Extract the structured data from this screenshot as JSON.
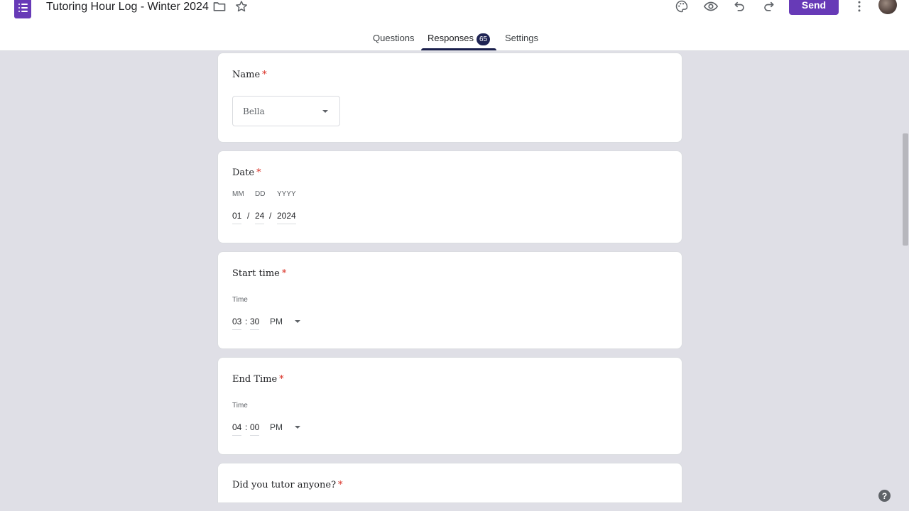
{
  "header": {
    "title": "Tutoring Hour Log - Winter 2024",
    "icons": [
      "forms-logo-icon",
      "folder-icon",
      "star-icon",
      "palette-icon",
      "preview-eye-icon",
      "undo-icon",
      "redo-icon",
      "more-vert-icon",
      "help-icon"
    ],
    "send_label": "Send"
  },
  "tabs": {
    "questions": "Questions",
    "responses": "Responses",
    "responses_count": "65",
    "settings": "Settings",
    "active": "Responses"
  },
  "questions": {
    "name": {
      "title": "Name",
      "required": "*",
      "selected": "Bella"
    },
    "date": {
      "title": "Date",
      "required": "*",
      "mm_label": "MM",
      "dd_label": "DD",
      "yyyy_label": "YYYY",
      "mm": "01",
      "dd": "24",
      "yyyy": "2024",
      "sep": "/"
    },
    "start_time": {
      "title": "Start time",
      "required": "*",
      "time_label": "Time",
      "hh": "03",
      "mm": "30",
      "colon": ":",
      "ampm": "PM"
    },
    "end_time": {
      "title": "End Time",
      "required": "*",
      "time_label": "Time",
      "hh": "04",
      "mm": "00",
      "colon": ":",
      "ampm": "PM"
    },
    "tutored": {
      "title": "Did you tutor anyone?",
      "required": "*"
    }
  },
  "help": {
    "label": "?"
  },
  "colors": {
    "accent": "#673ab7",
    "badge": "#1f2454",
    "required": "#d93025",
    "background": "#dfdfe6"
  }
}
